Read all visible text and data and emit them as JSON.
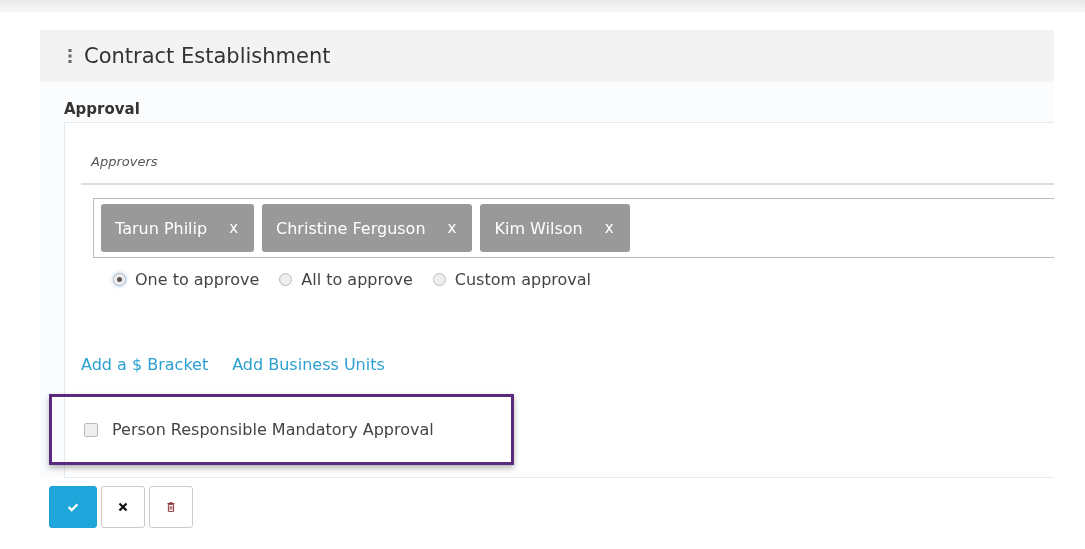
{
  "panel": {
    "title": "Contract Establishment"
  },
  "section": {
    "title": "Approval"
  },
  "approvers": {
    "label": "Approvers",
    "tags": [
      {
        "name": "Tarun Philip",
        "remove": "x"
      },
      {
        "name": "Christine Ferguson",
        "remove": "x"
      },
      {
        "name": "Kim Wilson",
        "remove": "x"
      }
    ]
  },
  "approval_modes": [
    {
      "label": "One to approve",
      "selected": true
    },
    {
      "label": "All to approve",
      "selected": false
    },
    {
      "label": "Custom approval",
      "selected": false
    }
  ],
  "links": [
    "Add a $ Bracket",
    "Add Business Units"
  ],
  "mandatory": {
    "label": "Person Responsible Mandatory Approval",
    "checked": false,
    "highlighted": true
  },
  "actions": [
    {
      "kind": "confirm"
    },
    {
      "kind": "cancel"
    },
    {
      "kind": "delete"
    }
  ]
}
